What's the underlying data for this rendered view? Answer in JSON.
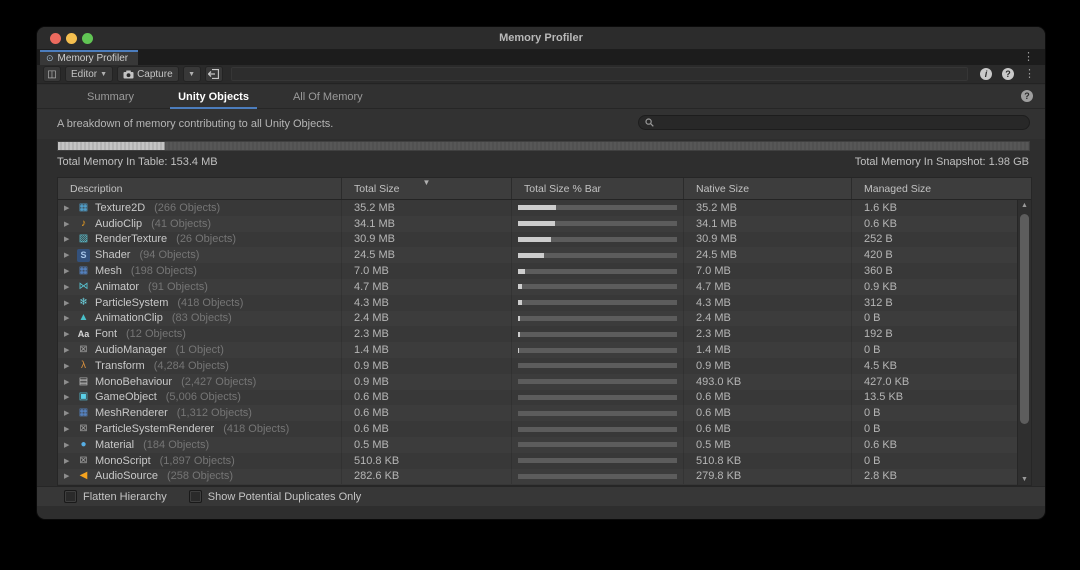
{
  "window": {
    "title": "Memory Profiler"
  },
  "doc_tab": {
    "label": "Memory Profiler"
  },
  "toolbar": {
    "editor_label": "Editor",
    "capture_label": "Capture"
  },
  "tabs": [
    {
      "label": "Summary",
      "active": false
    },
    {
      "label": "Unity Objects",
      "active": true
    },
    {
      "label": "All Of Memory",
      "active": false
    }
  ],
  "info": {
    "description": "A breakdown of memory contributing to all Unity Objects.",
    "search_placeholder": ""
  },
  "memory_bar": {
    "used_percent": 11
  },
  "totals": {
    "table_label": "Total Memory In Table: 153.4 MB",
    "snapshot_label": "Total Memory In Snapshot: 1.98 GB"
  },
  "table": {
    "columns": [
      "Description",
      "Total Size",
      "Total Size % Bar",
      "Native Size",
      "Managed Size"
    ],
    "sorted_column": "Total Size",
    "rows": [
      {
        "label": "Texture2D",
        "count": "(266 Objects)",
        "icon": "texture2d-icon",
        "glyph": "▦",
        "color": "#55b1e4",
        "total": "35.2 MB",
        "percent": 22.9,
        "native": "35.2 MB",
        "managed": "1.6 KB"
      },
      {
        "label": "AudioClip",
        "count": "(41 Objects)",
        "icon": "audioclip-icon",
        "glyph": "♪",
        "color": "#f5a31f",
        "total": "34.1 MB",
        "percent": 22.2,
        "native": "34.1 MB",
        "managed": "0.6 KB"
      },
      {
        "label": "RenderTexture",
        "count": "(26 Objects)",
        "icon": "rendertexture-icon",
        "glyph": "▨",
        "color": "#5ec8d8",
        "total": "30.9 MB",
        "percent": 20.1,
        "native": "30.9 MB",
        "managed": "252 B"
      },
      {
        "label": "Shader",
        "count": "(94 Objects)",
        "icon": "shader-icon",
        "glyph": "S",
        "color": "#a9c7ea",
        "bg": "#33517c",
        "total": "24.5 MB",
        "percent": 16.0,
        "native": "24.5 MB",
        "managed": "420 B"
      },
      {
        "label": "Mesh",
        "count": "(198 Objects)",
        "icon": "mesh-icon",
        "glyph": "▦",
        "color": "#5a8fd8",
        "total": "7.0 MB",
        "percent": 4.6,
        "native": "7.0 MB",
        "managed": "360 B"
      },
      {
        "label": "Animator",
        "count": "(91 Objects)",
        "icon": "animator-icon",
        "glyph": "⋈",
        "color": "#58c4d2",
        "total": "4.7 MB",
        "percent": 3.1,
        "native": "4.7 MB",
        "managed": "0.9 KB"
      },
      {
        "label": "ParticleSystem",
        "count": "(418 Objects)",
        "icon": "particlesystem-icon",
        "glyph": "❄",
        "color": "#6ed3e0",
        "total": "4.3 MB",
        "percent": 2.8,
        "native": "4.3 MB",
        "managed": "312 B"
      },
      {
        "label": "AnimationClip",
        "count": "(83 Objects)",
        "icon": "animationclip-icon",
        "glyph": "▲",
        "color": "#49c0c9",
        "total": "2.4 MB",
        "percent": 1.6,
        "native": "2.4 MB",
        "managed": "0 B"
      },
      {
        "label": "Font",
        "count": "(12 Objects)",
        "icon": "font-icon",
        "glyph": "Aa",
        "color": "#d8d8d8",
        "total": "2.3 MB",
        "percent": 1.5,
        "native": "2.3 MB",
        "managed": "192 B"
      },
      {
        "label": "AudioManager",
        "count": "(1 Object)",
        "icon": "audiomanager-icon",
        "glyph": "⊠",
        "color": "#9a9a9a",
        "total": "1.4 MB",
        "percent": 0.9,
        "native": "1.4 MB",
        "managed": "0 B"
      },
      {
        "label": "Transform",
        "count": "(4,284 Objects)",
        "icon": "transform-icon",
        "glyph": "λ",
        "color": "#d9913e",
        "total": "0.9 MB",
        "percent": 0.6,
        "native": "0.9 MB",
        "managed": "4.5 KB"
      },
      {
        "label": "MonoBehaviour",
        "count": "(2,427 Objects)",
        "icon": "monobehaviour-icon",
        "glyph": "▤",
        "color": "#c9c9c9",
        "total": "0.9 MB",
        "percent": 0.6,
        "native": "493.0 KB",
        "managed": "427.0 KB"
      },
      {
        "label": "GameObject",
        "count": "(5,006 Objects)",
        "icon": "gameobject-icon",
        "glyph": "▣",
        "color": "#5ad0e8",
        "total": "0.6 MB",
        "percent": 0.4,
        "native": "0.6 MB",
        "managed": "13.5 KB"
      },
      {
        "label": "MeshRenderer",
        "count": "(1,312 Objects)",
        "icon": "meshrenderer-icon",
        "glyph": "▦",
        "color": "#5a8fd8",
        "total": "0.6 MB",
        "percent": 0.4,
        "native": "0.6 MB",
        "managed": "0 B"
      },
      {
        "label": "ParticleSystemRenderer",
        "count": "(418 Objects)",
        "icon": "particlesystemrenderer-icon",
        "glyph": "⊠",
        "color": "#9a9a9a",
        "total": "0.6 MB",
        "percent": 0.4,
        "native": "0.6 MB",
        "managed": "0 B"
      },
      {
        "label": "Material",
        "count": "(184 Objects)",
        "icon": "material-icon",
        "glyph": "●",
        "color": "#57aee4",
        "total": "0.5 MB",
        "percent": 0.33,
        "native": "0.5 MB",
        "managed": "0.6 KB"
      },
      {
        "label": "MonoScript",
        "count": "(1,897 Objects)",
        "icon": "monoscript-icon",
        "glyph": "⊠",
        "color": "#9a9a9a",
        "total": "510.8 KB",
        "percent": 0.33,
        "native": "510.8 KB",
        "managed": "0 B"
      },
      {
        "label": "AudioSource",
        "count": "(258 Objects)",
        "icon": "audiosource-icon",
        "glyph": "◀",
        "color": "#f5a31f",
        "total": "282.6 KB",
        "percent": 0.18,
        "native": "279.8 KB",
        "managed": "2.8 KB"
      }
    ]
  },
  "footer": {
    "checkboxes": [
      "Flatten Hierarchy",
      "Show Potential Duplicates Only"
    ]
  }
}
